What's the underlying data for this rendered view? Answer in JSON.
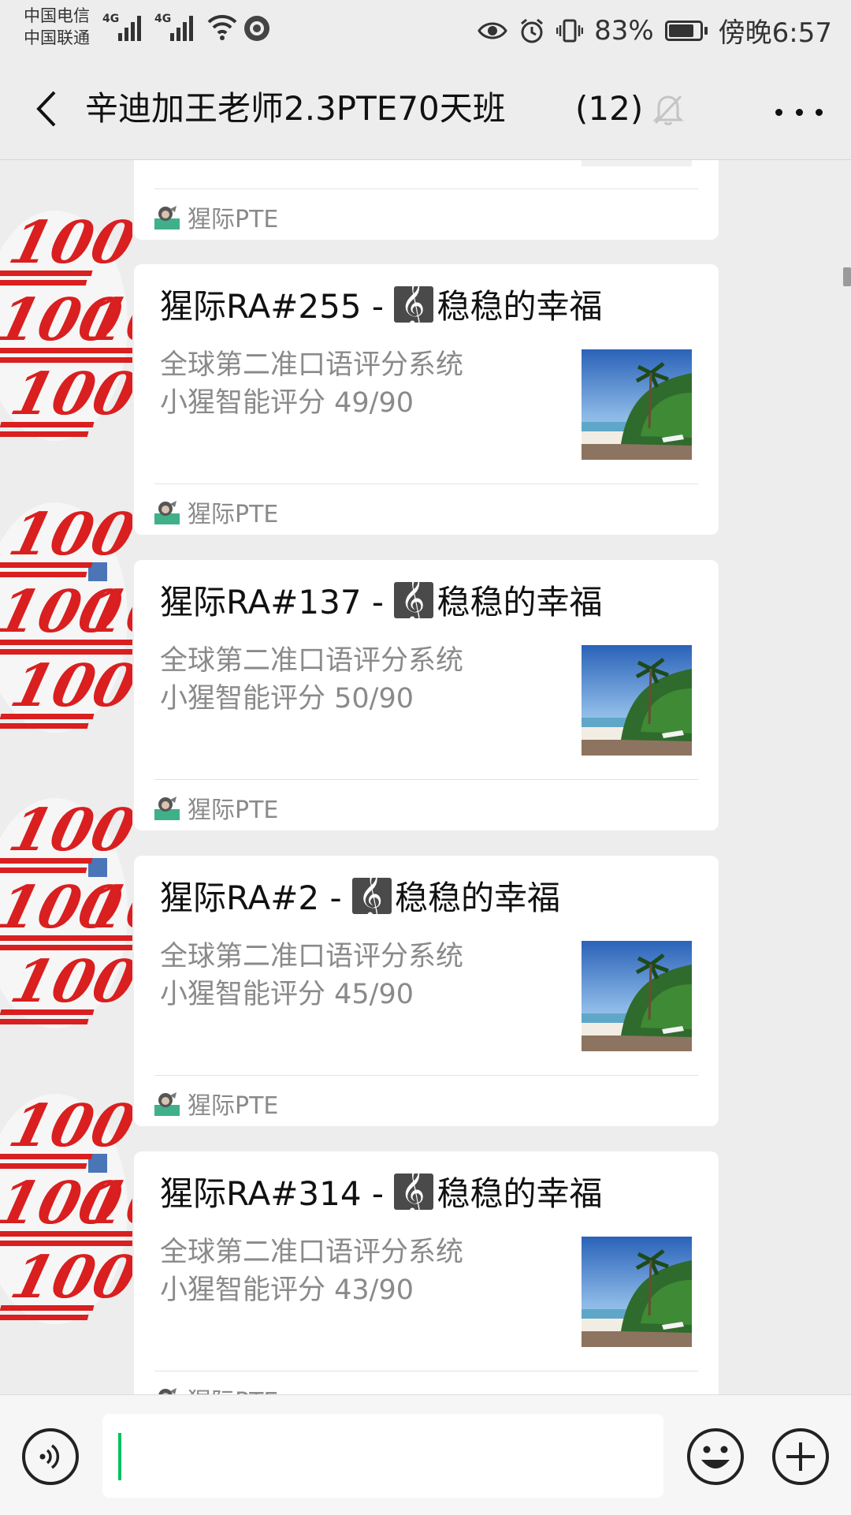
{
  "status_bar": {
    "carrier1": "中国电信",
    "carrier2": "中国联通",
    "network1": "4G",
    "network2": "4G",
    "battery": "83%",
    "battery_level": 0.83,
    "time": "傍晚6:57"
  },
  "header": {
    "title": "辛迪加王老师2.3PTE70天班",
    "member_count": "(12)",
    "icons": [
      "back-icon",
      "mute-bell-icon",
      "more-icon"
    ]
  },
  "messages": [
    {
      "title": "",
      "desc_line1": "",
      "desc_line2": "",
      "source": "猩际PTE"
    },
    {
      "title_prefix": "猩际RA#255 - ",
      "title_song": "稳稳的幸福",
      "desc_line1": "全球第二准口语评分系统",
      "desc_line2": "小猩智能评分 49/90",
      "source": "猩际PTE"
    },
    {
      "title_prefix": "猩际RA#137 - ",
      "title_song": "稳稳的幸福",
      "desc_line1": "全球第二准口语评分系统",
      "desc_line2": "小猩智能评分 50/90",
      "source": "猩际PTE"
    },
    {
      "title_prefix": "猩际RA#2 - ",
      "title_song": "稳稳的幸福",
      "desc_line1": "全球第二准口语评分系统",
      "desc_line2": "小猩智能评分 45/90",
      "source": "猩际PTE"
    },
    {
      "title_prefix": "猩际RA#314 - ",
      "title_song": "稳稳的幸福",
      "desc_line1": "全球第二准口语评分系统",
      "desc_line2": "小猩智能评分 43/90",
      "source": "猩际PTE"
    }
  ],
  "input_bar": {
    "icons": [
      "voice-icon",
      "emoji-icon",
      "plus-icon"
    ]
  },
  "colors": {
    "background": "#ededed",
    "card": "#ffffff",
    "accent": "#07c160",
    "hundred_red": "#d91f1f"
  }
}
